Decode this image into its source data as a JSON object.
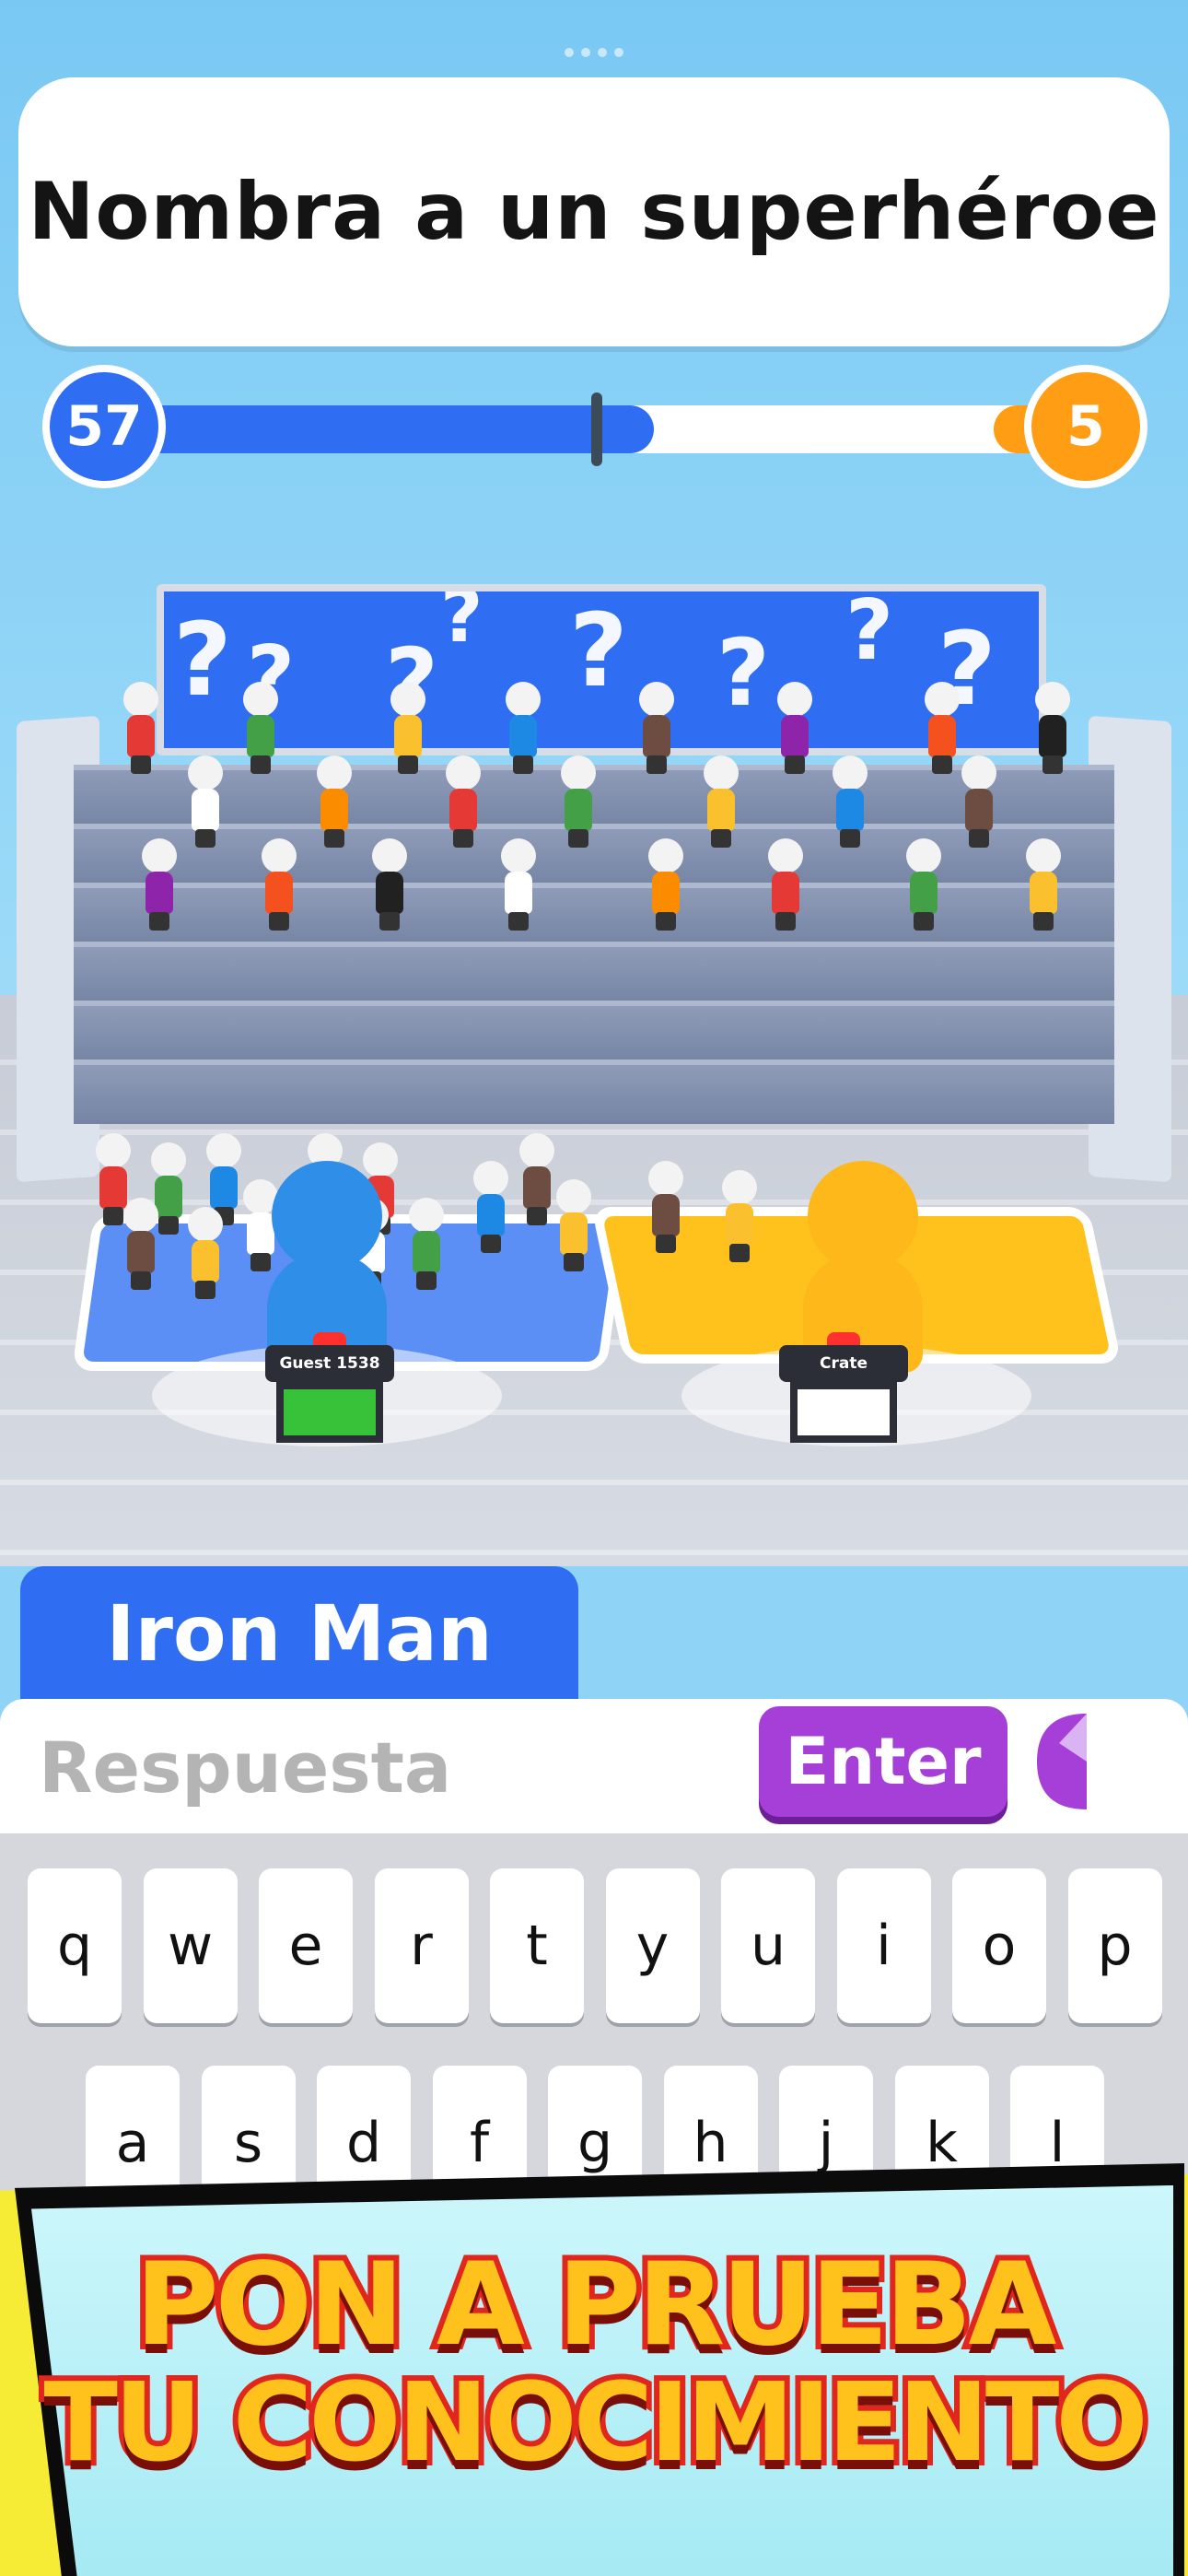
{
  "question": "Nombra a un superhéroe",
  "score": {
    "left": "57",
    "right": "5",
    "left_fraction": 0.57,
    "right_fraction": 0.05
  },
  "players": [
    {
      "name": "Guest 1538",
      "color": "#2f8fe8",
      "zone_color": "#5b8ff5",
      "podium_color": "#38c23a"
    },
    {
      "name": "Crate",
      "color": "#ffb81a",
      "zone_color": "#ffc21c",
      "podium_color": "#ffffff"
    }
  ],
  "last_answer": "Iron Man",
  "input": {
    "placeholder": "Respuesta",
    "value": ""
  },
  "enter_label": "Enter",
  "keyboard": {
    "row1": [
      "q",
      "w",
      "e",
      "r",
      "t",
      "y",
      "u",
      "i",
      "o",
      "p"
    ],
    "row2": [
      "a",
      "s",
      "d",
      "f",
      "g",
      "h",
      "j",
      "k",
      "l"
    ]
  },
  "promo": {
    "line1": "PON A PRUEBA",
    "line2": "TU CONOCIMIENTO"
  },
  "colors": {
    "blue": "#2f6ef2",
    "orange": "#ff9d14",
    "purple": "#a63fd8",
    "yellow": "#f7ec35",
    "red": "#e0261d"
  }
}
